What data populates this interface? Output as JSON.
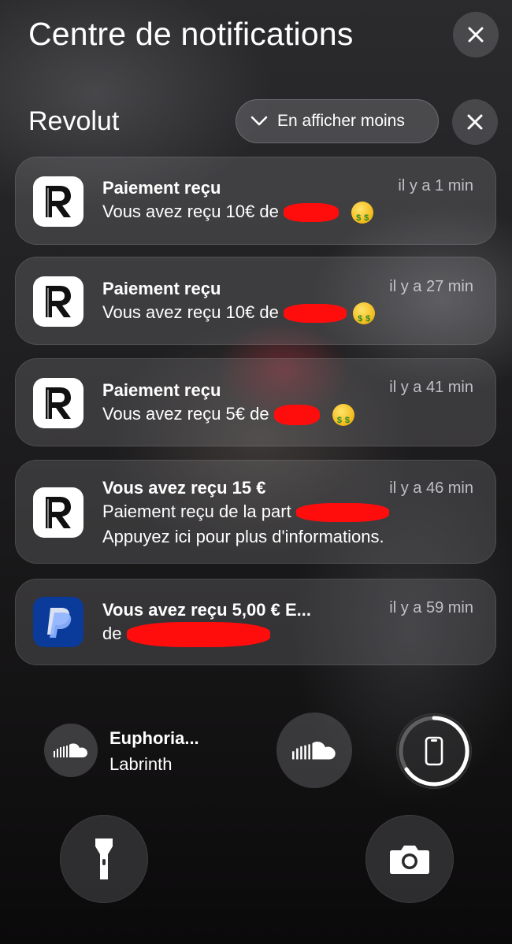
{
  "header": {
    "title": "Centre de notifications"
  },
  "group": {
    "title": "Revolut",
    "show_less_label": "En afficher moins"
  },
  "notifications": [
    {
      "app": "revolut",
      "title": "Paiement reçu",
      "time": "il y a 1 min",
      "body": "Vous avez reçu 10€ de",
      "body2": "",
      "emoji": "money-mouth-face"
    },
    {
      "app": "revolut",
      "title": "Paiement reçu",
      "time": "il y a 27 min",
      "body": "Vous avez reçu 10€ de",
      "body2": "",
      "emoji": "money-mouth-face"
    },
    {
      "app": "revolut",
      "title": "Paiement reçu",
      "time": "il y a 41 min",
      "body": "Vous avez reçu 5€ de",
      "body2": "",
      "emoji": "money-mouth-face"
    },
    {
      "app": "revolut",
      "title": "Vous avez reçu 15 €",
      "time": "il y a 46 min",
      "body": "Paiement reçu de la part",
      "body2": "Appuyez ici pour plus d'informations."
    },
    {
      "app": "paypal",
      "title": "Vous avez reçu 5,00 € E...",
      "time": "il y a 59 min",
      "body": "de",
      "body2": ""
    }
  ],
  "media": {
    "track": "Euphoria...",
    "artist": "Labrinth"
  },
  "icons": {
    "close": "close-icon",
    "chevron": "chevron-down-icon",
    "soundcloud": "soundcloud-icon",
    "phone": "phone-icon",
    "flashlight": "flashlight-icon",
    "camera": "camera-icon"
  },
  "colors": {
    "redaction": "#ff0d0d",
    "paypal": "#0b3b9a"
  }
}
